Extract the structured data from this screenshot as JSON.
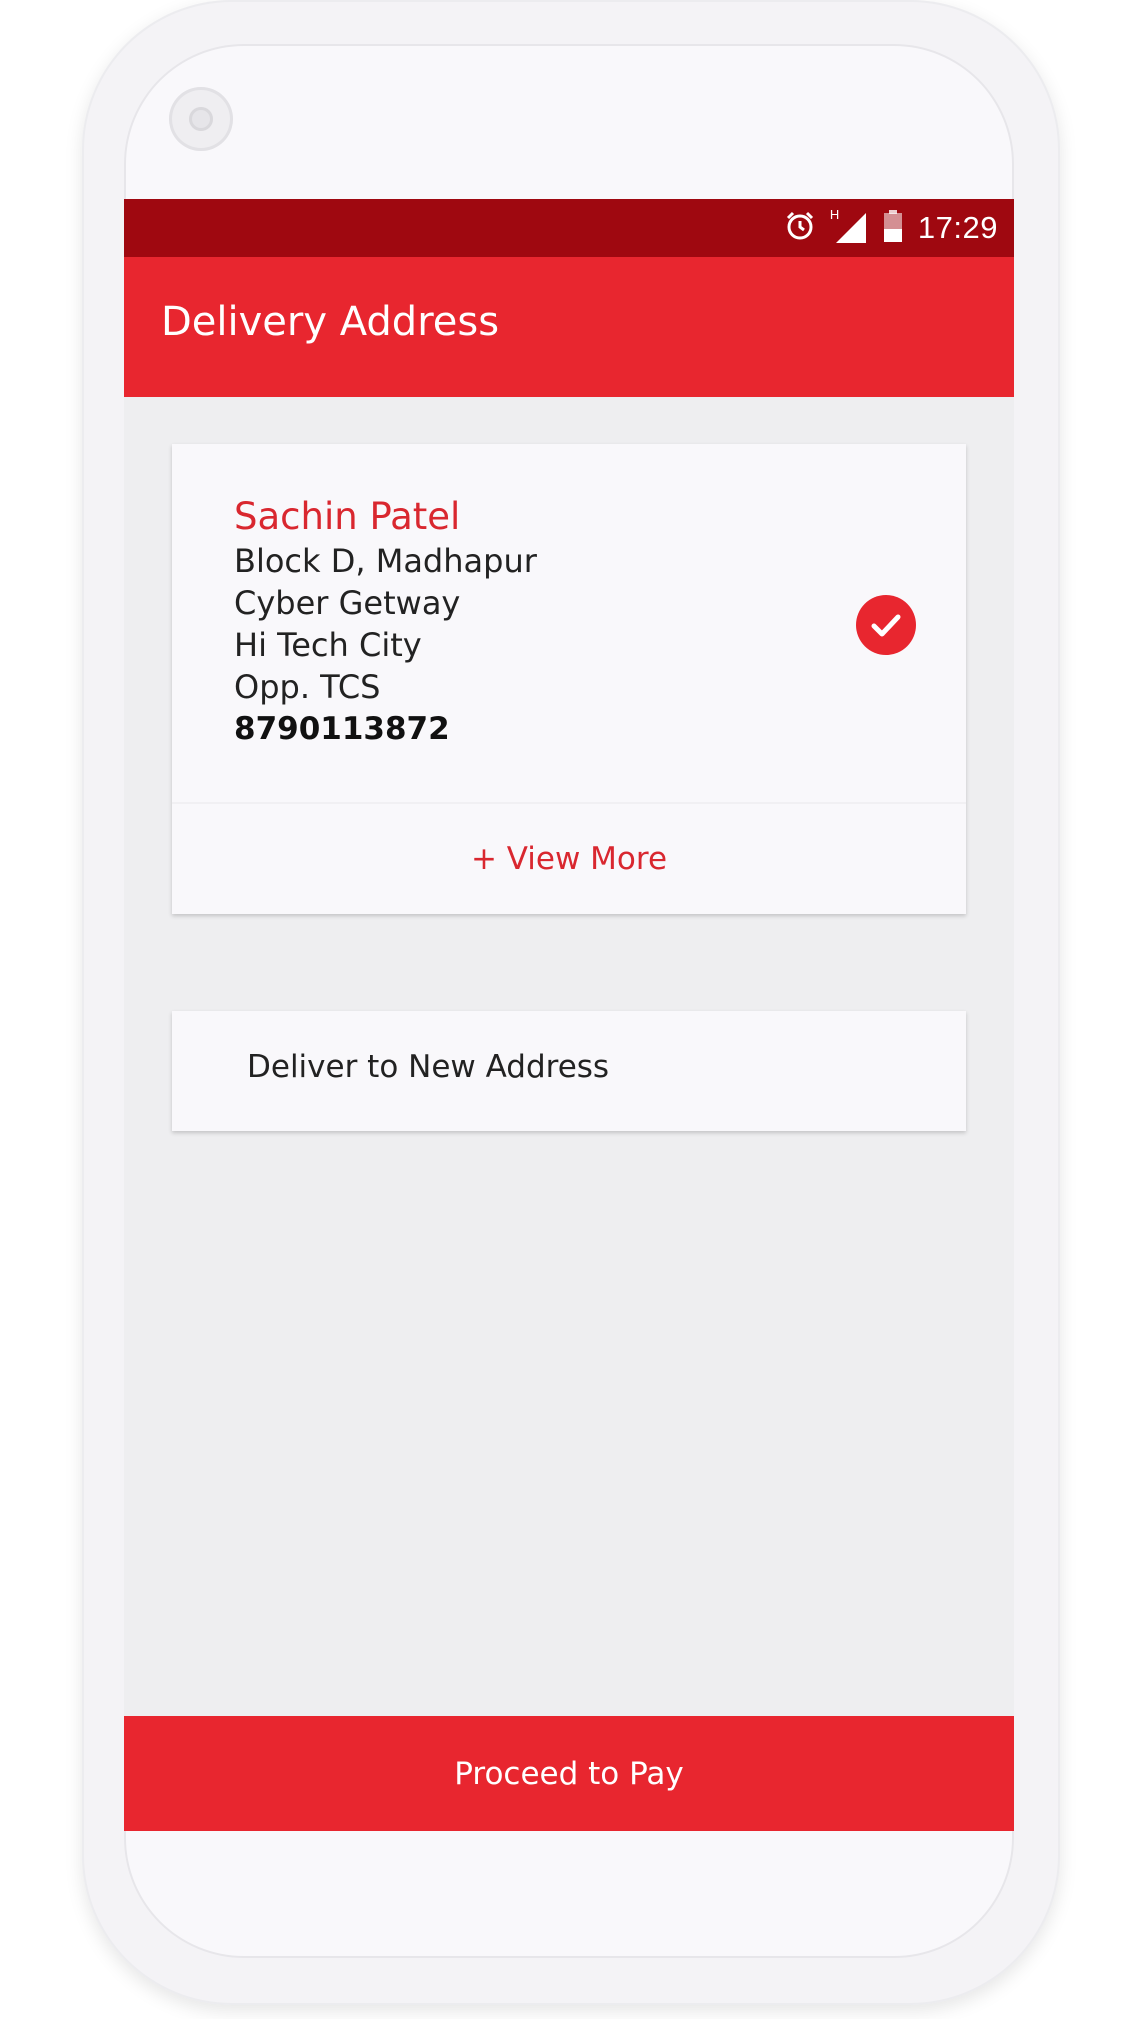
{
  "status_bar": {
    "time": "17:29",
    "icons": [
      "alarm-icon",
      "signal-icon",
      "battery-icon"
    ],
    "network_label": "H"
  },
  "app_bar": {
    "title": "Delivery Address"
  },
  "address_card": {
    "name": "Sachin Patel",
    "lines": [
      "Block D, Madhapur",
      "Cyber Getway",
      "Hi Tech City",
      "Opp. TCS"
    ],
    "phone": "8790113872",
    "selected": true,
    "view_more_label": "+ View More"
  },
  "new_address": {
    "label": "Deliver to New Address"
  },
  "footer": {
    "proceed_label": "Proceed to Pay"
  },
  "colors": {
    "primary": "#e8262f",
    "status_bar": "#9f0810",
    "accent_text": "#d9272f",
    "background": "#eeeef0",
    "card": "#f9f8fb"
  }
}
